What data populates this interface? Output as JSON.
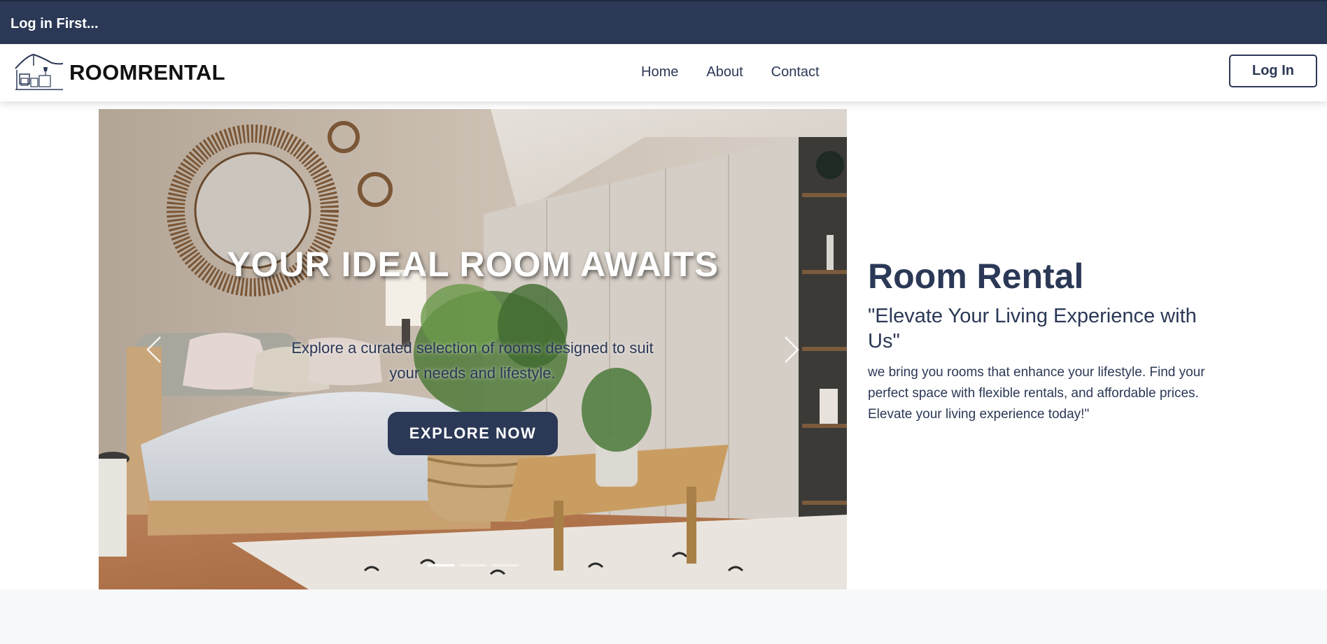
{
  "topbar": {
    "message": "Log in First..."
  },
  "navbar": {
    "brand": "ROOMRENTAL",
    "logo_icon": "house-furniture-logo-icon",
    "links": [
      "Home",
      "About",
      "Contact"
    ],
    "login_label": "Log In"
  },
  "hero": {
    "title": "YOUR IDEAL ROOM AWAITS",
    "subtitle": "Explore a curated selection of rooms designed to suit your needs and lifestyle.",
    "button_label": "EXPLORE NOW",
    "slide_count": 3,
    "active_slide": 1,
    "prev_icon": "chevron-left-icon",
    "next_icon": "chevron-right-icon"
  },
  "info": {
    "title": "Room Rental",
    "tagline": "\"Elevate Your Living Experience with Us\"",
    "body": "we bring you rooms that enhance your lifestyle. Find your perfect space with flexible rentals, and affordable prices. Elevate your living experience today!\""
  },
  "colors": {
    "primary": "#2b3856",
    "topbar": "#2b3856",
    "background": "#ffffff",
    "band": "#f7f8fa"
  }
}
